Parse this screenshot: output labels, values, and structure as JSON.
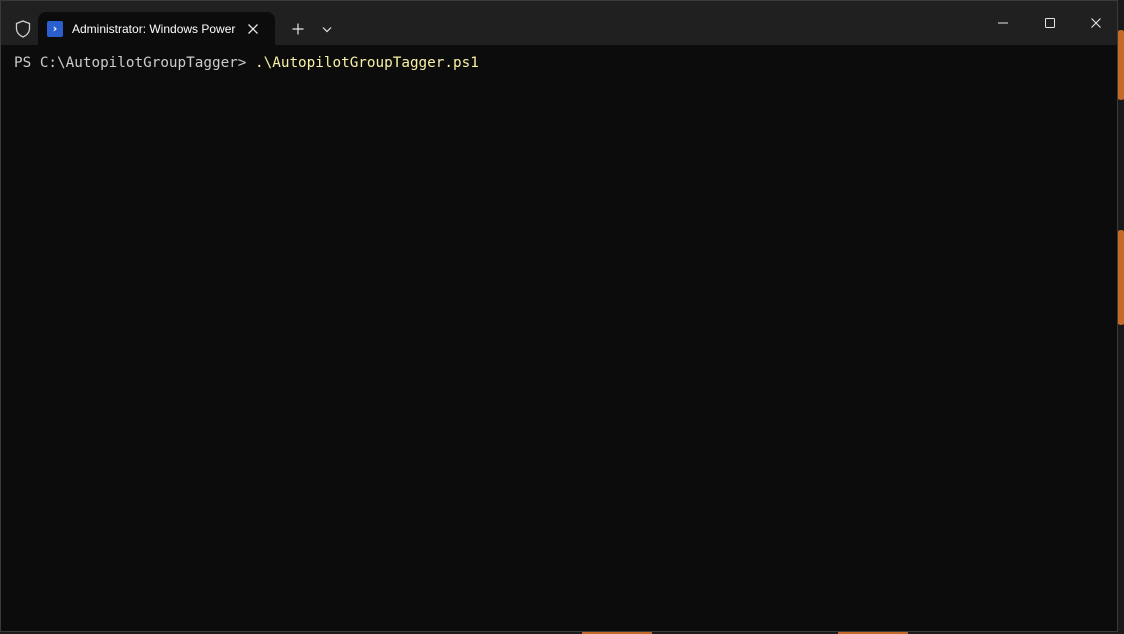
{
  "colors": {
    "terminal_background": "#0c0c0c",
    "titlebar_background": "#202020",
    "prompt_text": "#cccccc",
    "command_text": "#f9f1a5",
    "powershell_icon": "#2b5fcf",
    "wallpaper_accent": "#c8692c"
  },
  "titlebar": {
    "shield_icon": "shield-icon",
    "tab": {
      "icon": "powershell-icon",
      "icon_glyph": "›",
      "title": "Administrator: Windows PowerShell",
      "close_icon": "close-icon"
    },
    "new_tab_icon": "plus-icon",
    "dropdown_icon": "chevron-down-icon",
    "window_controls": {
      "minimize_icon": "minimize-icon",
      "maximize_icon": "maximize-icon",
      "close_icon": "close-icon"
    }
  },
  "terminal": {
    "lines": [
      {
        "prompt": "PS C:\\AutopilotGroupTagger> ",
        "command": ".\\AutopilotGroupTagger.ps1"
      }
    ]
  }
}
